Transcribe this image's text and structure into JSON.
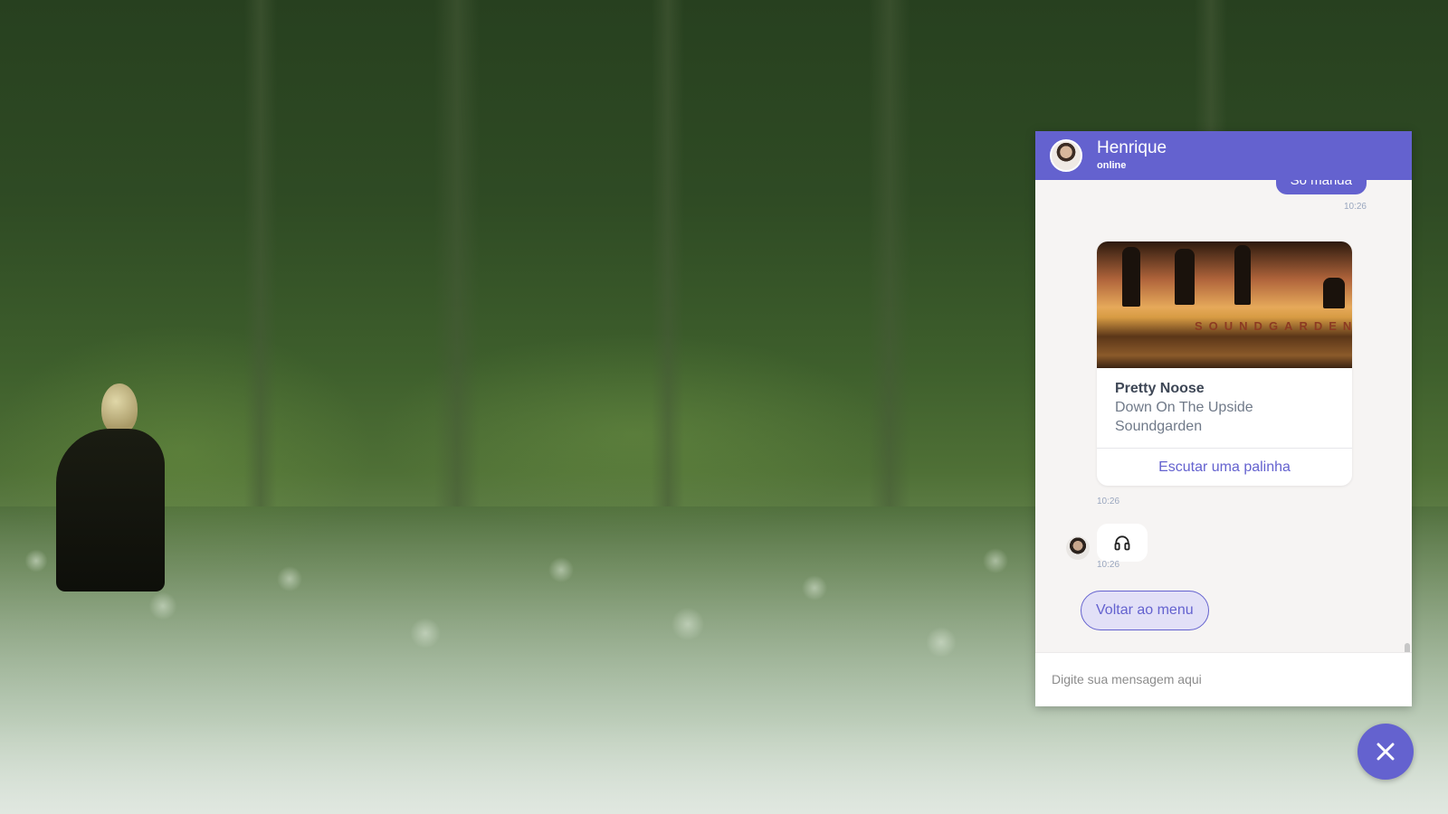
{
  "header": {
    "name": "Henrique",
    "status": "online"
  },
  "messages": {
    "outgoing_text": "Só manda",
    "outgoing_time": "10:26",
    "card": {
      "cover_text": "SOUNDGARDEN",
      "title": "Pretty Noose",
      "album": "Down On The Upside",
      "artist": "Soundgarden",
      "link_label": "Escutar uma palinha",
      "time": "10:26"
    },
    "icon_bubble": {
      "icon": "headphones-icon",
      "time": "10:26"
    },
    "menu_button_label": "Voltar ao menu"
  },
  "composer": {
    "placeholder": "Digite sua mensagem aqui",
    "value": ""
  },
  "colors": {
    "accent": "#6462cf",
    "chat_bg": "#f6f4f3",
    "menu_button_bg": "#e2e0f7"
  }
}
